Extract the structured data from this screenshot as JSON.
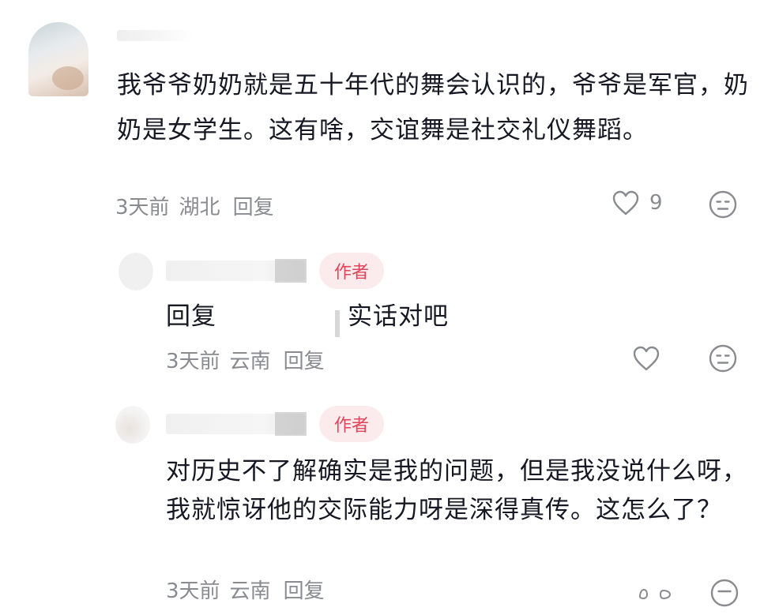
{
  "comment": {
    "text": "我爷爷奶奶就是五十年代的舞会认识的，爷爷是军官，奶奶是女学生。这有啥，交谊舞是社交礼仪舞蹈。",
    "time": "3天前",
    "location": "湖北",
    "reply_label": "回复",
    "like_count": "9",
    "like_icon": "heart-outline-icon",
    "dislike_icon": "meh-face-icon"
  },
  "replies": [
    {
      "badge": "作者",
      "text_prefix": "回复",
      "text_body": "实话对吧",
      "time": "3天前",
      "location": "云南",
      "reply_label": "回复"
    },
    {
      "badge": "作者",
      "text": "对历史不了解确实是我的问题，但是我没说什么呀，我就惊讶他的交际能力呀是深得真传。这怎么了？",
      "time": "3天前",
      "location": "云南",
      "reply_label": "回复"
    }
  ],
  "colors": {
    "text": "#161823",
    "meta": "#8a8b91",
    "badge_bg": "#fbebec",
    "badge_text": "#e0455b"
  }
}
